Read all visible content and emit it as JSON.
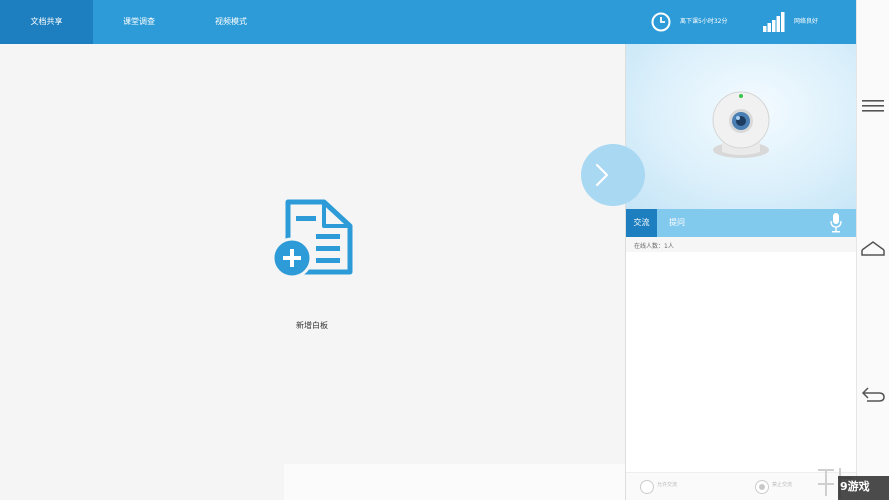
{
  "topbar": {
    "tabs": [
      {
        "label": "文档共享",
        "active": true
      },
      {
        "label": "课堂调查",
        "active": false
      },
      {
        "label": "视频模式",
        "active": false
      }
    ],
    "time_remaining": "离下课5小时32分",
    "network_status": "网络良好",
    "clock_icon": "clock-icon",
    "signal_icon": "signal-icon"
  },
  "main": {
    "add_whiteboard_label": "新增白板",
    "add_whiteboard_icon": "document-add-icon"
  },
  "panel": {
    "tabs": [
      {
        "label": "交流",
        "active": true
      },
      {
        "label": "提问",
        "active": false
      }
    ],
    "online_count": "在线人数：1人",
    "radio_options": [
      {
        "label": "允许交流",
        "selected": false
      },
      {
        "label": "禁止交流",
        "selected": true
      }
    ]
  },
  "watermark": "9游戏",
  "colors": {
    "topbar": "#2d9bd7",
    "active_tab": "#1d7fbf",
    "chat_tabs": "#82c9ee",
    "icon_blue": "#2d9bd7"
  }
}
